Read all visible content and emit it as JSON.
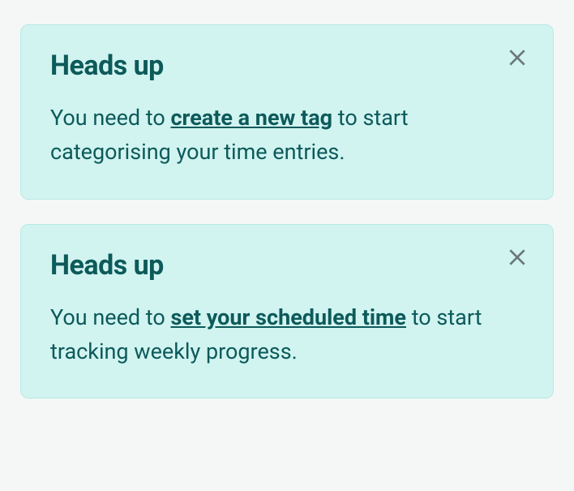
{
  "alerts": [
    {
      "title": "Heads up",
      "text_before": "You need to ",
      "link_text": "create a new tag",
      "text_after": " to start categorising your time entries."
    },
    {
      "title": "Heads up",
      "text_before": "You need to ",
      "link_text": "set your scheduled time",
      "text_after": " to start tracking weekly progress."
    }
  ]
}
